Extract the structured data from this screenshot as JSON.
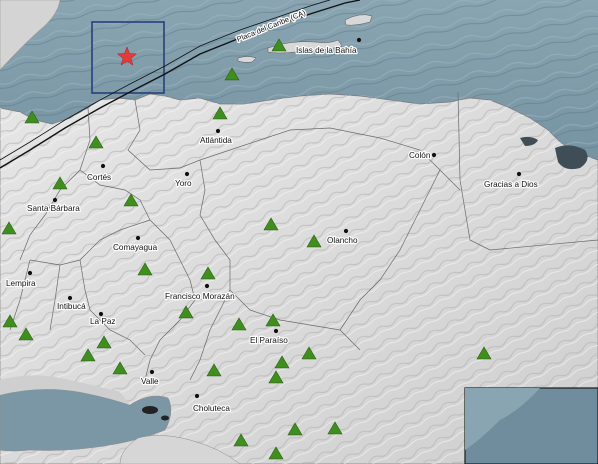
{
  "map": {
    "plate_boundary_label": "Placa del Caribe (CA)",
    "colors": {
      "sea": "#6f8d9c",
      "land": "#dcdcdc",
      "station": "#3f8f1e",
      "epicenter": "#e23b3b",
      "study_box": "#25407a"
    },
    "places": [
      {
        "name": "Islas de la Bahía"
      },
      {
        "name": "Atlántida"
      },
      {
        "name": "Colón"
      },
      {
        "name": "Cortés"
      },
      {
        "name": "Yoro"
      },
      {
        "name": "Gracias a Dios"
      },
      {
        "name": "Santa Bárbara"
      },
      {
        "name": "Olancho"
      },
      {
        "name": "Comayagua"
      },
      {
        "name": "Lempira"
      },
      {
        "name": "Francisco Morazán"
      },
      {
        "name": "Intibucá"
      },
      {
        "name": "La Paz"
      },
      {
        "name": "El Paraíso"
      },
      {
        "name": "Valle"
      },
      {
        "name": "Choluteca"
      }
    ],
    "symbols": {
      "station_icon": "green-triangle",
      "epicenter_icon": "red-star",
      "city_icon": "black-dot"
    }
  }
}
